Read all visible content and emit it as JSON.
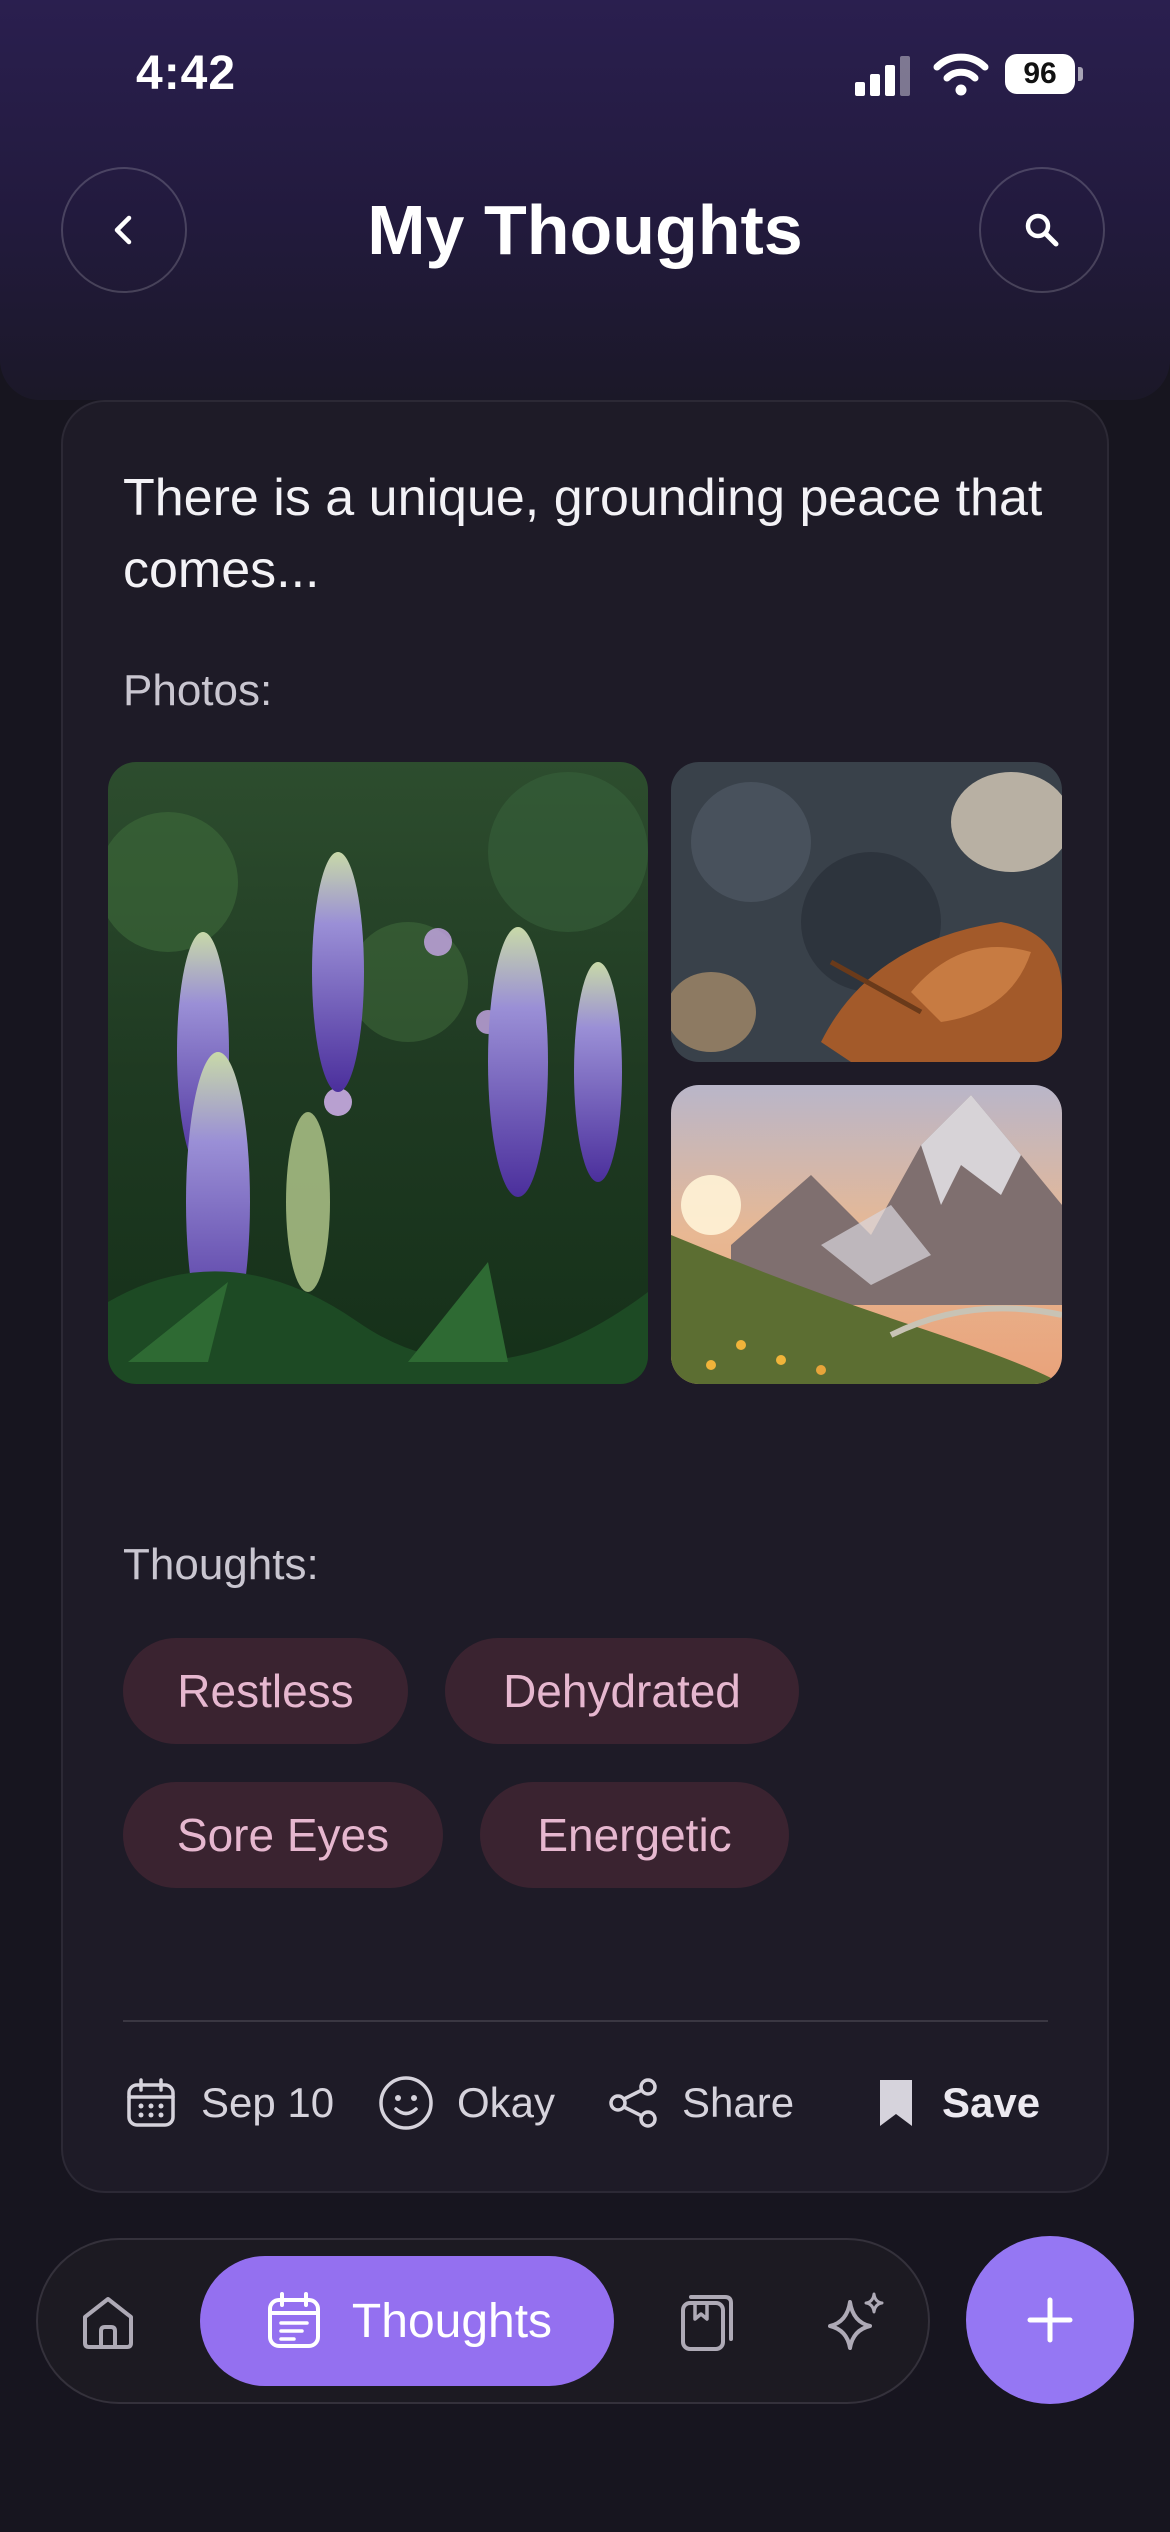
{
  "status_bar": {
    "time": "4:42",
    "battery": "96"
  },
  "header": {
    "title": "My Thoughts"
  },
  "entry": {
    "excerpt": "There is a unique, grounding peace that comes...",
    "photos_label": "Photos:",
    "thoughts_label": "Thoughts:",
    "tags": [
      "Restless",
      "Dehydrated",
      "Sore Eyes",
      "Energetic"
    ],
    "footer": {
      "date": "Sep 10",
      "mood": "Okay",
      "share": "Share",
      "save": "Save"
    }
  },
  "nav": {
    "active_label": "Thoughts"
  },
  "colors": {
    "accent": "#9470f0",
    "chip_bg": "#3a2330",
    "chip_text": "#e6b7cf",
    "card_bg": "#1e1b27"
  },
  "icons": [
    "signal-icon",
    "wifi-icon",
    "battery-icon",
    "back-icon",
    "search-icon",
    "calendar-icon",
    "smiley-icon",
    "share-icon",
    "bookmark-icon",
    "home-icon",
    "thoughts-icon",
    "journal-icon",
    "sparkle-icon",
    "plus-icon"
  ]
}
